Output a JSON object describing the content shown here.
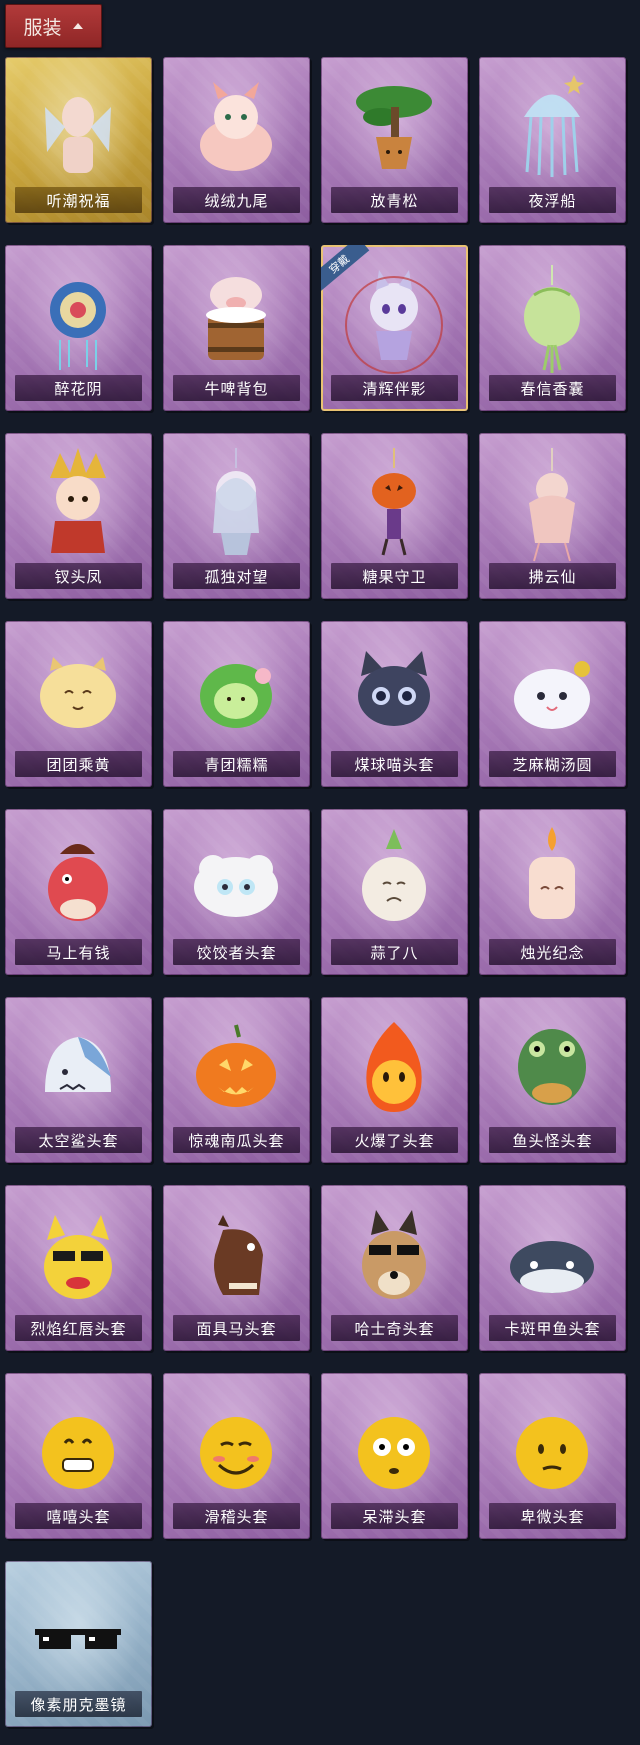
{
  "header": {
    "title": "服装",
    "chevron_icon": "chevron-up-icon"
  },
  "items": [
    {
      "name": "听潮祝福",
      "icon": "ethereal-figure-icon",
      "rarity": "gold"
    },
    {
      "name": "绒绒九尾",
      "icon": "nine-tailed-fox-icon",
      "rarity": "purple"
    },
    {
      "name": "放青松",
      "icon": "bonsai-pine-icon",
      "rarity": "purple"
    },
    {
      "name": "夜浮船",
      "icon": "jellyfish-icon",
      "rarity": "purple"
    },
    {
      "name": "醉花阴",
      "icon": "flower-ornament-icon",
      "rarity": "purple"
    },
    {
      "name": "牛啤背包",
      "icon": "cow-barrel-icon",
      "rarity": "purple"
    },
    {
      "name": "清辉伴影",
      "icon": "fox-spirit-doll-icon",
      "rarity": "purple",
      "equipped": true,
      "badge": "穿戴"
    },
    {
      "name": "春信香囊",
      "icon": "sachet-icon",
      "rarity": "purple"
    },
    {
      "name": "钗头凤",
      "icon": "phoenix-crown-doll-icon",
      "rarity": "purple"
    },
    {
      "name": "孤独对望",
      "icon": "hanging-doll-icon",
      "rarity": "purple"
    },
    {
      "name": "糖果守卫",
      "icon": "pumpkin-lantern-icon",
      "rarity": "purple"
    },
    {
      "name": "拂云仙",
      "icon": "fairy-pendant-icon",
      "rarity": "purple"
    },
    {
      "name": "团团乘黄",
      "icon": "yellow-blob-icon",
      "rarity": "purple"
    },
    {
      "name": "青团糯糯",
      "icon": "green-dumpling-icon",
      "rarity": "purple"
    },
    {
      "name": "煤球喵头套",
      "icon": "black-cat-head-icon",
      "rarity": "purple"
    },
    {
      "name": "芝麻糊汤圆",
      "icon": "rice-ball-icon",
      "rarity": "purple"
    },
    {
      "name": "马上有钱",
      "icon": "red-horse-head-icon",
      "rarity": "purple"
    },
    {
      "name": "饺饺者头套",
      "icon": "dumpling-cloud-head-icon",
      "rarity": "purple"
    },
    {
      "name": "蒜了八",
      "icon": "garlic-head-icon",
      "rarity": "purple"
    },
    {
      "name": "烛光纪念",
      "icon": "candle-head-icon",
      "rarity": "purple"
    },
    {
      "name": "太空鲨头套",
      "icon": "shark-head-icon",
      "rarity": "purple"
    },
    {
      "name": "惊魂南瓜头套",
      "icon": "jack-o-lantern-icon",
      "rarity": "purple"
    },
    {
      "name": "火爆了头套",
      "icon": "fire-spirit-head-icon",
      "rarity": "purple"
    },
    {
      "name": "鱼头怪头套",
      "icon": "fish-head-icon",
      "rarity": "purple"
    },
    {
      "name": "烈焰红唇头套",
      "icon": "yellow-sunglasses-head-icon",
      "rarity": "purple"
    },
    {
      "name": "面具马头套",
      "icon": "horse-mask-icon",
      "rarity": "purple"
    },
    {
      "name": "哈士奇头套",
      "icon": "husky-sunglasses-icon",
      "rarity": "purple"
    },
    {
      "name": "卡斑甲鱼头套",
      "icon": "flat-fish-head-icon",
      "rarity": "purple"
    },
    {
      "name": "嘻嘻头套",
      "icon": "grin-emoji-icon",
      "rarity": "purple"
    },
    {
      "name": "滑稽头套",
      "icon": "smirk-emoji-icon",
      "rarity": "purple"
    },
    {
      "name": "呆滞头套",
      "icon": "dazed-emoji-icon",
      "rarity": "purple"
    },
    {
      "name": "卑微头套",
      "icon": "humble-emoji-icon",
      "rarity": "purple"
    },
    {
      "name": "像素朋克墨镜",
      "icon": "pixel-sunglasses-icon",
      "rarity": "blue"
    }
  ],
  "colors": {
    "background": "#141a27",
    "header": "#a63131",
    "purple": "#a97bb8",
    "gold": "#c9a53c",
    "blue": "#97b3c9",
    "equipped_border": "#e8c271"
  }
}
